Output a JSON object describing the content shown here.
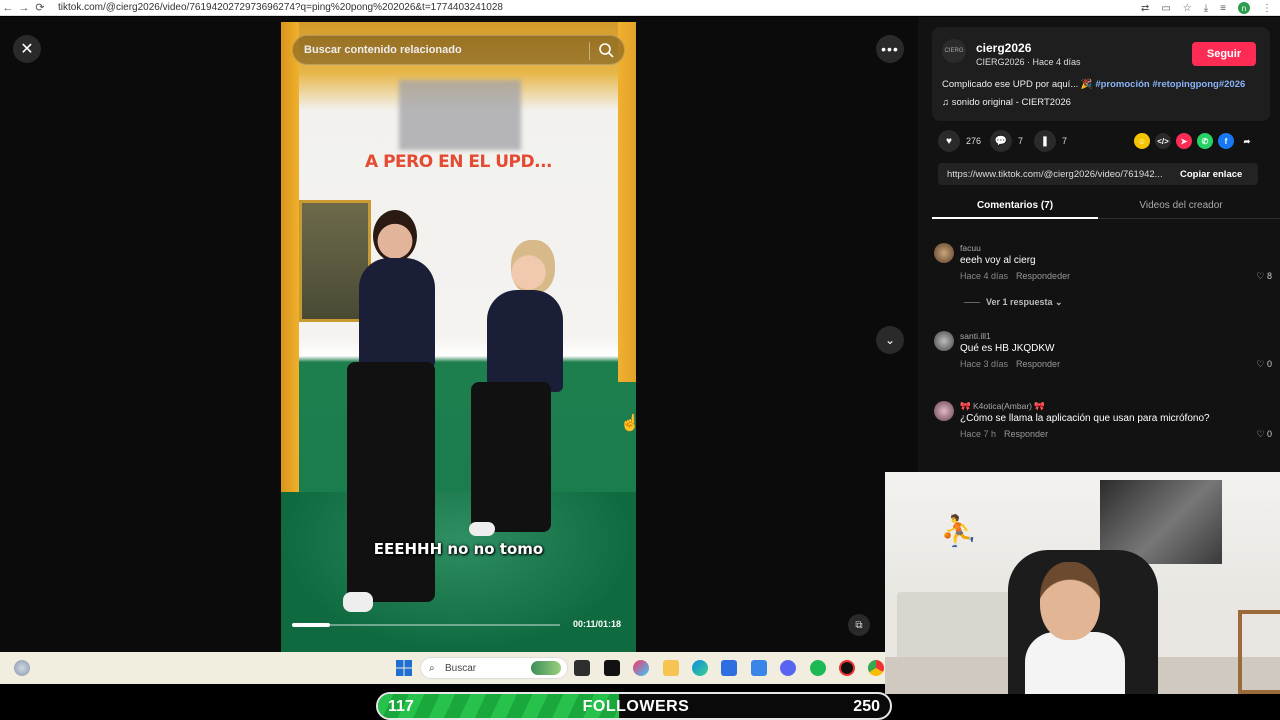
{
  "browser": {
    "url": "tiktok.com/@cierg2026/video/7619420272973696274?q=ping%20pong%202026&t=1774403241028",
    "back": "←",
    "forward": "→",
    "reload": "⟳"
  },
  "video": {
    "search_placeholder": "Buscar contenido relacionado",
    "overlay_text": "A PERO EN EL UPD...",
    "caption": "EEEHHH no no tomo",
    "time": "00:11/01:18",
    "progress": 0.14
  },
  "creator": {
    "avatar_text": "CIERG",
    "username": "cierg2026",
    "meta": "CIERG2026 · Hace 4 días",
    "follow_label": "Seguir",
    "description": "Complicado ese UPD por aquí... 🎉",
    "hashtags": "#promoción #retopingpong#2026",
    "sound": "♫  sonido original - CIERT2026"
  },
  "stats": {
    "likes": "276",
    "comments": "7",
    "saves": "7"
  },
  "share_link": {
    "url": "https://www.tiktok.com/@cierg2026/video/761942...",
    "copy_label": "Copiar enlace"
  },
  "tabs": {
    "comments": "Comentarios (7)",
    "creator_videos": "Videos del creador"
  },
  "comments": [
    {
      "user": "facuu",
      "text": "eeeh voy al cierg",
      "time": "Hace 4 días",
      "reply": "Respondeder",
      "likes": "♡ 8"
    },
    {
      "user": "santi.ill1",
      "text": "Qué es HB JKQDKW",
      "time": "Hace 3 días",
      "reply": "Responder",
      "likes": "♡ 0"
    },
    {
      "user": "🎀 K4otica(Ambar) 🎀",
      "text": "¿Cómo se llama la aplicación que usan para micrófono?",
      "time": "Hace 7 h",
      "reply": "Responder",
      "likes": "♡ 0"
    }
  ],
  "view_replies": "Ver 1 respuesta ⌄",
  "taskbar": {
    "search": "Buscar"
  },
  "followers": {
    "current": "117",
    "label": "FOLLOWERS",
    "goal": "250",
    "current_value": 117,
    "goal_value": 250
  }
}
